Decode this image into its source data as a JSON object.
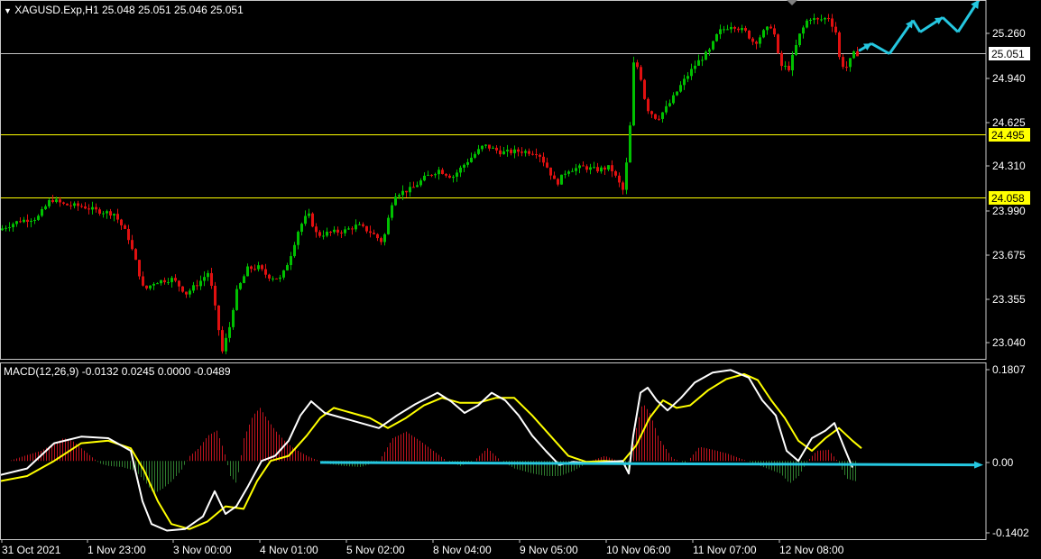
{
  "header": {
    "symbol_line": "XAGUSD.Exp,H1  25.048 25.051 25.046 25.051",
    "macd_line": "MACD(12,26,9) -0.0132 0.0245 0.0000 -0.0489"
  },
  "colors": {
    "background": "#000000",
    "bull": "#00c000",
    "bear": "#e01010",
    "level": "#ffff00",
    "current_price_line": "#c0c0c0",
    "forecast": "#25c7e0",
    "macd_main": "#ffffff",
    "macd_signal": "#ffff00",
    "hist_pos": "#c0141f",
    "hist_neg": "#2f7d2f"
  },
  "chart_data": [
    {
      "type": "candlestick",
      "symbol": "XAGUSD.Exp",
      "timeframe": "H1",
      "last_quote": {
        "open": 25.048,
        "high": 25.051,
        "low": 25.046,
        "close": 25.051
      },
      "ylim": [
        22.95,
        25.42
      ],
      "y_ticks": [
        "25.260",
        "24.940",
        "24.625",
        "24.310",
        "23.990",
        "23.675",
        "23.355",
        "23.040"
      ],
      "x_ticks": [
        "31 Oct 2021",
        "1 Nov 23:00",
        "3 Nov 00:00",
        "4 Nov 01:00",
        "5 Nov 02:00",
        "8 Nov 04:00",
        "9 Nov 05:00",
        "10 Nov 06:00",
        "11 Nov 07:00",
        "12 Nov 08:00"
      ],
      "close_path": [
        [
          0,
          23.83
        ],
        [
          10,
          23.86
        ],
        [
          25,
          23.9
        ],
        [
          45,
          23.92
        ],
        [
          60,
          24.05
        ],
        [
          75,
          24.01
        ],
        [
          95,
          24.0
        ],
        [
          110,
          23.97
        ],
        [
          130,
          23.95
        ],
        [
          145,
          23.8
        ],
        [
          155,
          23.6
        ],
        [
          163,
          23.42
        ],
        [
          175,
          23.48
        ],
        [
          195,
          23.5
        ],
        [
          210,
          23.4
        ],
        [
          225,
          23.48
        ],
        [
          235,
          23.55
        ],
        [
          242,
          23.3
        ],
        [
          250,
          23.0
        ],
        [
          258,
          23.17
        ],
        [
          265,
          23.4
        ],
        [
          278,
          23.57
        ],
        [
          290,
          23.58
        ],
        [
          300,
          23.52
        ],
        [
          315,
          23.5
        ],
        [
          325,
          23.65
        ],
        [
          335,
          23.85
        ],
        [
          345,
          23.95
        ],
        [
          355,
          23.8
        ],
        [
          370,
          23.82
        ],
        [
          385,
          23.83
        ],
        [
          400,
          23.87
        ],
        [
          415,
          23.82
        ],
        [
          428,
          23.75
        ],
        [
          440,
          24.08
        ],
        [
          460,
          24.12
        ],
        [
          475,
          24.2
        ],
        [
          490,
          24.25
        ],
        [
          505,
          24.2
        ],
        [
          520,
          24.3
        ],
        [
          540,
          24.42
        ],
        [
          560,
          24.37
        ],
        [
          580,
          24.38
        ],
        [
          600,
          24.37
        ],
        [
          612,
          24.25
        ],
        [
          620,
          24.15
        ],
        [
          632,
          24.25
        ],
        [
          650,
          24.27
        ],
        [
          665,
          24.25
        ],
        [
          680,
          24.27
        ],
        [
          695,
          24.1
        ],
        [
          702,
          24.55
        ],
        [
          706,
          24.98
        ],
        [
          712,
          24.95
        ],
        [
          720,
          24.68
        ],
        [
          732,
          24.6
        ],
        [
          745,
          24.7
        ],
        [
          760,
          24.85
        ],
        [
          775,
          24.98
        ],
        [
          790,
          25.07
        ],
        [
          800,
          25.2
        ],
        [
          815,
          25.25
        ],
        [
          830,
          25.2
        ],
        [
          840,
          25.12
        ],
        [
          850,
          25.2
        ],
        [
          860,
          25.25
        ],
        [
          868,
          24.97
        ],
        [
          878,
          24.95
        ],
        [
          890,
          25.18
        ],
        [
          900,
          25.3
        ],
        [
          910,
          25.28
        ],
        [
          922,
          25.3
        ],
        [
          930,
          25.2
        ],
        [
          935,
          24.98
        ],
        [
          942,
          24.96
        ],
        [
          950,
          25.05
        ]
      ],
      "horizontal_levels": [
        {
          "price": 25.051,
          "label": "25.051",
          "kind": "current"
        },
        {
          "price": 24.495,
          "label": "24.495",
          "kind": "level"
        },
        {
          "price": 24.058,
          "label": "24.058",
          "kind": "level"
        }
      ],
      "forecast_path": [
        [
          952,
          25.07
        ],
        [
          966,
          25.12
        ],
        [
          986,
          25.05
        ],
        [
          1012,
          25.28
        ],
        [
          1020,
          25.2
        ],
        [
          1045,
          25.3
        ],
        [
          1062,
          25.2
        ],
        [
          1085,
          25.42
        ]
      ]
    },
    {
      "type": "macd",
      "title": "MACD(12,26,9)",
      "values": {
        "main": -0.0132,
        "signal": 0.0245,
        "extra_1": 0.0,
        "extra_2": -0.0489
      },
      "ylim": [
        -0.155,
        0.195
      ],
      "y_ticks": [
        "0.1807",
        "0.00",
        "-0.1402"
      ],
      "main_path": [
        [
          0,
          -0.028
        ],
        [
          30,
          -0.015
        ],
        [
          60,
          0.035
        ],
        [
          90,
          0.048
        ],
        [
          120,
          0.045
        ],
        [
          145,
          0.02
        ],
        [
          158,
          -0.08
        ],
        [
          168,
          -0.125
        ],
        [
          185,
          -0.138
        ],
        [
          205,
          -0.135
        ],
        [
          225,
          -0.11
        ],
        [
          238,
          -0.06
        ],
        [
          250,
          -0.105
        ],
        [
          262,
          -0.09
        ],
        [
          275,
          -0.05
        ],
        [
          290,
          0.0
        ],
        [
          305,
          0.01
        ],
        [
          320,
          0.04
        ],
        [
          333,
          0.09
        ],
        [
          345,
          0.118
        ],
        [
          360,
          0.095
        ],
        [
          380,
          0.085
        ],
        [
          400,
          0.075
        ],
        [
          420,
          0.065
        ],
        [
          440,
          0.09
        ],
        [
          460,
          0.112
        ],
        [
          485,
          0.135
        ],
        [
          500,
          0.118
        ],
        [
          515,
          0.095
        ],
        [
          530,
          0.11
        ],
        [
          545,
          0.135
        ],
        [
          560,
          0.12
        ],
        [
          575,
          0.09
        ],
        [
          590,
          0.05
        ],
        [
          605,
          0.02
        ],
        [
          620,
          -0.008
        ],
        [
          635,
          -0.002
        ],
        [
          655,
          -0.005
        ],
        [
          675,
          -0.002
        ],
        [
          690,
          0.0
        ],
        [
          697,
          -0.025
        ],
        [
          702,
          0.05
        ],
        [
          710,
          0.135
        ],
        [
          718,
          0.145
        ],
        [
          728,
          0.12
        ],
        [
          740,
          0.1
        ],
        [
          755,
          0.125
        ],
        [
          770,
          0.155
        ],
        [
          790,
          0.175
        ],
        [
          810,
          0.18
        ],
        [
          830,
          0.165
        ],
        [
          845,
          0.12
        ],
        [
          860,
          0.09
        ],
        [
          872,
          0.02
        ],
        [
          885,
          0.0
        ],
        [
          900,
          0.045
        ],
        [
          915,
          0.06
        ],
        [
          925,
          0.075
        ],
        [
          935,
          0.03
        ],
        [
          945,
          -0.013
        ]
      ],
      "signal_path": [
        [
          0,
          -0.04
        ],
        [
          30,
          -0.03
        ],
        [
          60,
          0.0
        ],
        [
          90,
          0.035
        ],
        [
          120,
          0.04
        ],
        [
          145,
          0.025
        ],
        [
          160,
          -0.02
        ],
        [
          175,
          -0.08
        ],
        [
          190,
          -0.125
        ],
        [
          210,
          -0.135
        ],
        [
          230,
          -0.12
        ],
        [
          250,
          -0.09
        ],
        [
          270,
          -0.095
        ],
        [
          285,
          -0.04
        ],
        [
          300,
          0.0
        ],
        [
          320,
          0.01
        ],
        [
          340,
          0.05
        ],
        [
          355,
          0.085
        ],
        [
          370,
          0.105
        ],
        [
          390,
          0.095
        ],
        [
          410,
          0.085
        ],
        [
          430,
          0.065
        ],
        [
          450,
          0.085
        ],
        [
          470,
          0.11
        ],
        [
          490,
          0.125
        ],
        [
          510,
          0.115
        ],
        [
          530,
          0.115
        ],
        [
          550,
          0.125
        ],
        [
          570,
          0.125
        ],
        [
          590,
          0.09
        ],
        [
          610,
          0.05
        ],
        [
          630,
          0.01
        ],
        [
          650,
          -0.002
        ],
        [
          670,
          0.0
        ],
        [
          690,
          -0.002
        ],
        [
          705,
          0.03
        ],
        [
          720,
          0.085
        ],
        [
          735,
          0.12
        ],
        [
          750,
          0.105
        ],
        [
          765,
          0.11
        ],
        [
          785,
          0.14
        ],
        [
          805,
          0.162
        ],
        [
          825,
          0.172
        ],
        [
          840,
          0.16
        ],
        [
          855,
          0.12
        ],
        [
          870,
          0.085
        ],
        [
          885,
          0.04
        ],
        [
          900,
          0.02
        ],
        [
          915,
          0.045
        ],
        [
          930,
          0.065
        ],
        [
          945,
          0.04
        ],
        [
          955,
          0.025
        ]
      ],
      "histogram": [
        [
          10,
          0.0
        ],
        [
          30,
          0.012
        ],
        [
          45,
          0.02
        ],
        [
          60,
          0.035
        ],
        [
          70,
          0.045
        ],
        [
          80,
          0.04
        ],
        [
          90,
          0.025
        ],
        [
          100,
          0.01
        ],
        [
          110,
          -0.005
        ],
        [
          120,
          -0.01
        ],
        [
          135,
          -0.012
        ],
        [
          150,
          -0.02
        ],
        [
          160,
          -0.04
        ],
        [
          170,
          -0.065
        ],
        [
          180,
          -0.055
        ],
        [
          190,
          -0.04
        ],
        [
          200,
          -0.02
        ],
        [
          210,
          0.01
        ],
        [
          220,
          0.025
        ],
        [
          230,
          0.05
        ],
        [
          240,
          0.06
        ],
        [
          248,
          0.02
        ],
        [
          255,
          -0.03
        ],
        [
          262,
          -0.045
        ],
        [
          270,
          0.045
        ],
        [
          280,
          0.09
        ],
        [
          288,
          0.105
        ],
        [
          295,
          0.085
        ],
        [
          305,
          0.06
        ],
        [
          315,
          0.04
        ],
        [
          325,
          0.025
        ],
        [
          340,
          0.01
        ],
        [
          360,
          -0.005
        ],
        [
          380,
          -0.01
        ],
        [
          400,
          -0.012
        ],
        [
          420,
          0.0
        ],
        [
          435,
          0.045
        ],
        [
          450,
          0.058
        ],
        [
          465,
          0.04
        ],
        [
          480,
          0.02
        ],
        [
          495,
          0.0
        ],
        [
          510,
          -0.01
        ],
        [
          525,
          0.0
        ],
        [
          540,
          0.025
        ],
        [
          555,
          0.0
        ],
        [
          570,
          -0.015
        ],
        [
          590,
          -0.025
        ],
        [
          605,
          -0.03
        ],
        [
          620,
          -0.03
        ],
        [
          635,
          -0.02
        ],
        [
          655,
          0.0
        ],
        [
          670,
          0.01
        ],
        [
          685,
          0.0
        ],
        [
          697,
          -0.02
        ],
        [
          705,
          0.065
        ],
        [
          712,
          0.115
        ],
        [
          720,
          0.095
        ],
        [
          730,
          0.045
        ],
        [
          745,
          0.005
        ],
        [
          760,
          -0.005
        ],
        [
          775,
          0.028
        ],
        [
          790,
          0.022
        ],
        [
          805,
          0.015
        ],
        [
          820,
          0.005
        ],
        [
          835,
          -0.005
        ],
        [
          850,
          -0.015
        ],
        [
          865,
          -0.025
        ],
        [
          875,
          -0.045
        ],
        [
          885,
          -0.03
        ],
        [
          895,
          0.0
        ],
        [
          905,
          0.02
        ],
        [
          918,
          0.022
        ],
        [
          928,
          0.0
        ],
        [
          938,
          -0.035
        ],
        [
          948,
          -0.04
        ]
      ],
      "forecast_line": [
        [
          355,
          -0.003
        ],
        [
          1090,
          -0.008
        ]
      ]
    }
  ]
}
